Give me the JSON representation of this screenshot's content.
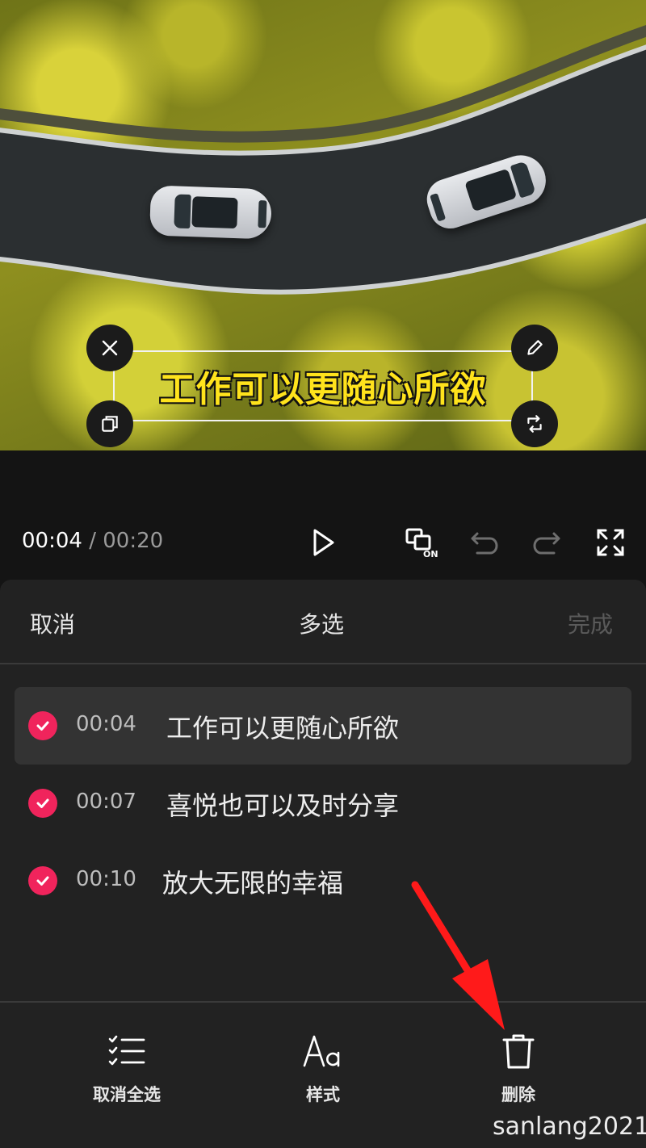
{
  "preview": {
    "subtitle": "工作可以更随心所欲"
  },
  "playback": {
    "current_time": "00:04",
    "separator": "/",
    "duration": "00:20"
  },
  "panel": {
    "cancel_label": "取消",
    "title": "多选",
    "done_label": "完成"
  },
  "subtitle_list": [
    {
      "time": "00:04",
      "text": "工作可以更随心所欲",
      "checked": true
    },
    {
      "time": "00:07",
      "text": "喜悦也可以及时分享",
      "checked": true
    },
    {
      "time": "00:10",
      "text": "放大无限的幸福",
      "checked": true
    }
  ],
  "toolbar": {
    "deselect_all_label": "取消全选",
    "style_label": "样式",
    "delete_label": "删除"
  },
  "watermark": "sanlang2021",
  "colors": {
    "accent_check": "#f0245c",
    "subtitle_fill": "#ffe31c",
    "annotation_arrow": "#ff1a1a"
  }
}
